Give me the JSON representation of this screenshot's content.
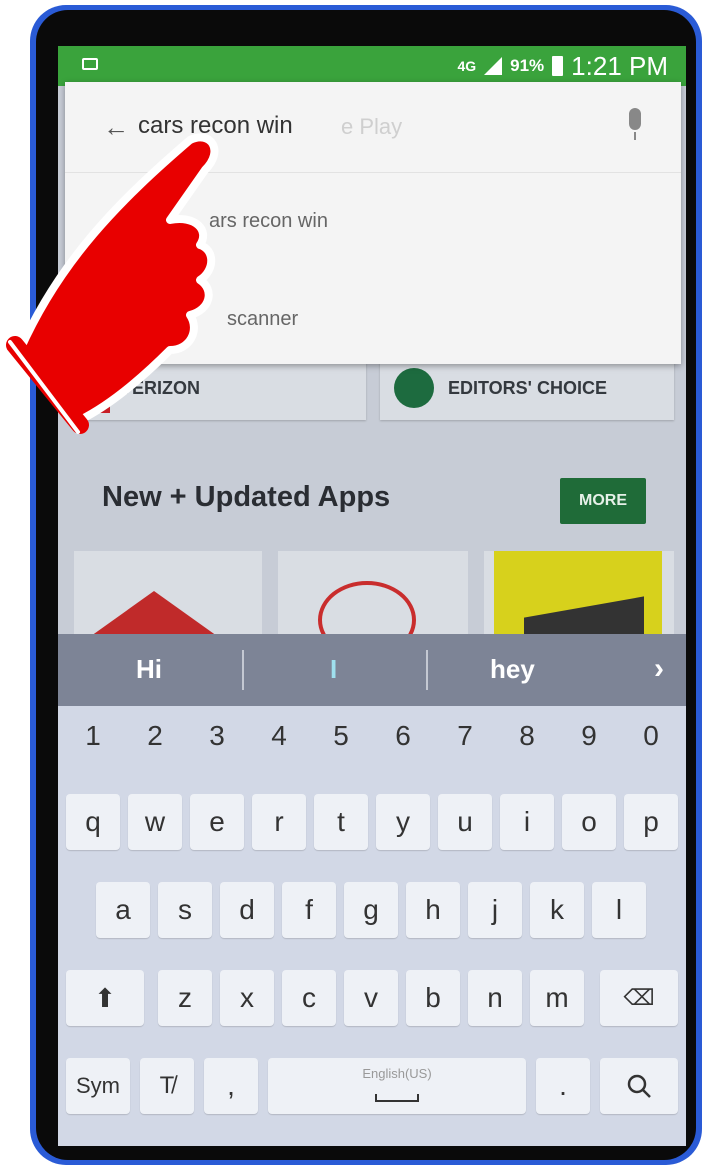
{
  "status_bar": {
    "network": "4G",
    "battery": "91%",
    "time": "1:21 PM"
  },
  "search": {
    "query": "cars recon win",
    "hint": "e Play",
    "suggestions": [
      "ars recon win",
      "scanner"
    ]
  },
  "cards": {
    "left": "VERIZON",
    "right": "EDITORS' CHOICE"
  },
  "section": {
    "title": "New + Updated Apps",
    "more": "MORE"
  },
  "keyboard": {
    "suggestions": [
      "Hi",
      "I",
      "hey"
    ],
    "numbers": [
      "1",
      "2",
      "3",
      "4",
      "5",
      "6",
      "7",
      "8",
      "9",
      "0"
    ],
    "row1": [
      "q",
      "w",
      "e",
      "r",
      "t",
      "y",
      "u",
      "i",
      "o",
      "p"
    ],
    "row2": [
      "a",
      "s",
      "d",
      "f",
      "g",
      "h",
      "j",
      "k",
      "l"
    ],
    "row3": [
      "z",
      "x",
      "c",
      "v",
      "b",
      "n",
      "m"
    ],
    "sym": "Sym",
    "comma": ",",
    "space_label": "English(US)",
    "period": "."
  },
  "icons": {
    "back": "arrow-left",
    "mic": "microphone",
    "shift": "arrow-up",
    "backspace": "backspace",
    "search": "magnifier",
    "handwriting": "pen"
  }
}
